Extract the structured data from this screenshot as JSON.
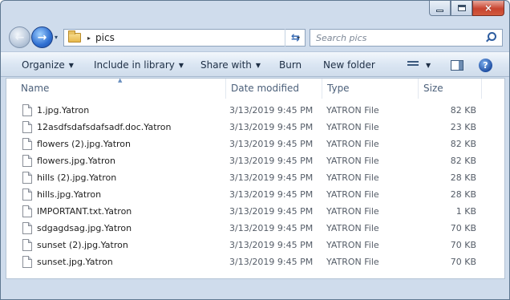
{
  "window": {
    "caption": {
      "minimize_glyph": "minimize-icon",
      "maximize_glyph": "maximize-icon",
      "close_glyph": "×"
    }
  },
  "nav": {
    "back_glyph": "←",
    "forward_glyph": "→",
    "history_glyph": "▾",
    "breadcrumb_sep": "▸",
    "current_folder": "pics",
    "address_dropdown_glyph": "▾",
    "refresh_glyph": "⇆",
    "search_placeholder": "Search pics"
  },
  "toolbar": {
    "organize": "Organize",
    "include_in_library": "Include in library",
    "share_with": "Share with",
    "burn": "Burn",
    "new_folder": "New folder",
    "dropdown_glyph": "▼",
    "view_dropdown_glyph": "▼",
    "help_glyph": "?"
  },
  "columns": {
    "sort_glyph": "▲",
    "name": "Name",
    "date_modified": "Date modified",
    "type": "Type",
    "size": "Size"
  },
  "files": [
    {
      "name": "1.jpg.Yatron",
      "date": "3/13/2019 9:45 PM",
      "type": "YATRON File",
      "size": "82 KB"
    },
    {
      "name": "12asdfsdafsdafsadf.doc.Yatron",
      "date": "3/13/2019 9:45 PM",
      "type": "YATRON File",
      "size": "23 KB"
    },
    {
      "name": "flowers (2).jpg.Yatron",
      "date": "3/13/2019 9:45 PM",
      "type": "YATRON File",
      "size": "82 KB"
    },
    {
      "name": "flowers.jpg.Yatron",
      "date": "3/13/2019 9:45 PM",
      "type": "YATRON File",
      "size": "82 KB"
    },
    {
      "name": "hills (2).jpg.Yatron",
      "date": "3/13/2019 9:45 PM",
      "type": "YATRON File",
      "size": "28 KB"
    },
    {
      "name": "hills.jpg.Yatron",
      "date": "3/13/2019 9:45 PM",
      "type": "YATRON File",
      "size": "28 KB"
    },
    {
      "name": "IMPORTANT.txt.Yatron",
      "date": "3/13/2019 9:45 PM",
      "type": "YATRON File",
      "size": "1 KB"
    },
    {
      "name": "sdgagdsag.jpg.Yatron",
      "date": "3/13/2019 9:45 PM",
      "type": "YATRON File",
      "size": "70 KB"
    },
    {
      "name": "sunset (2).jpg.Yatron",
      "date": "3/13/2019 9:45 PM",
      "type": "YATRON File",
      "size": "70 KB"
    },
    {
      "name": "sunset.jpg.Yatron",
      "date": "3/13/2019 9:45 PM",
      "type": "YATRON File",
      "size": "70 KB"
    }
  ],
  "colors": {
    "frame": "#cfdcec",
    "close_button": "#c7432f",
    "accent_blue": "#2f6fd1",
    "header_text": "#4c607a"
  }
}
